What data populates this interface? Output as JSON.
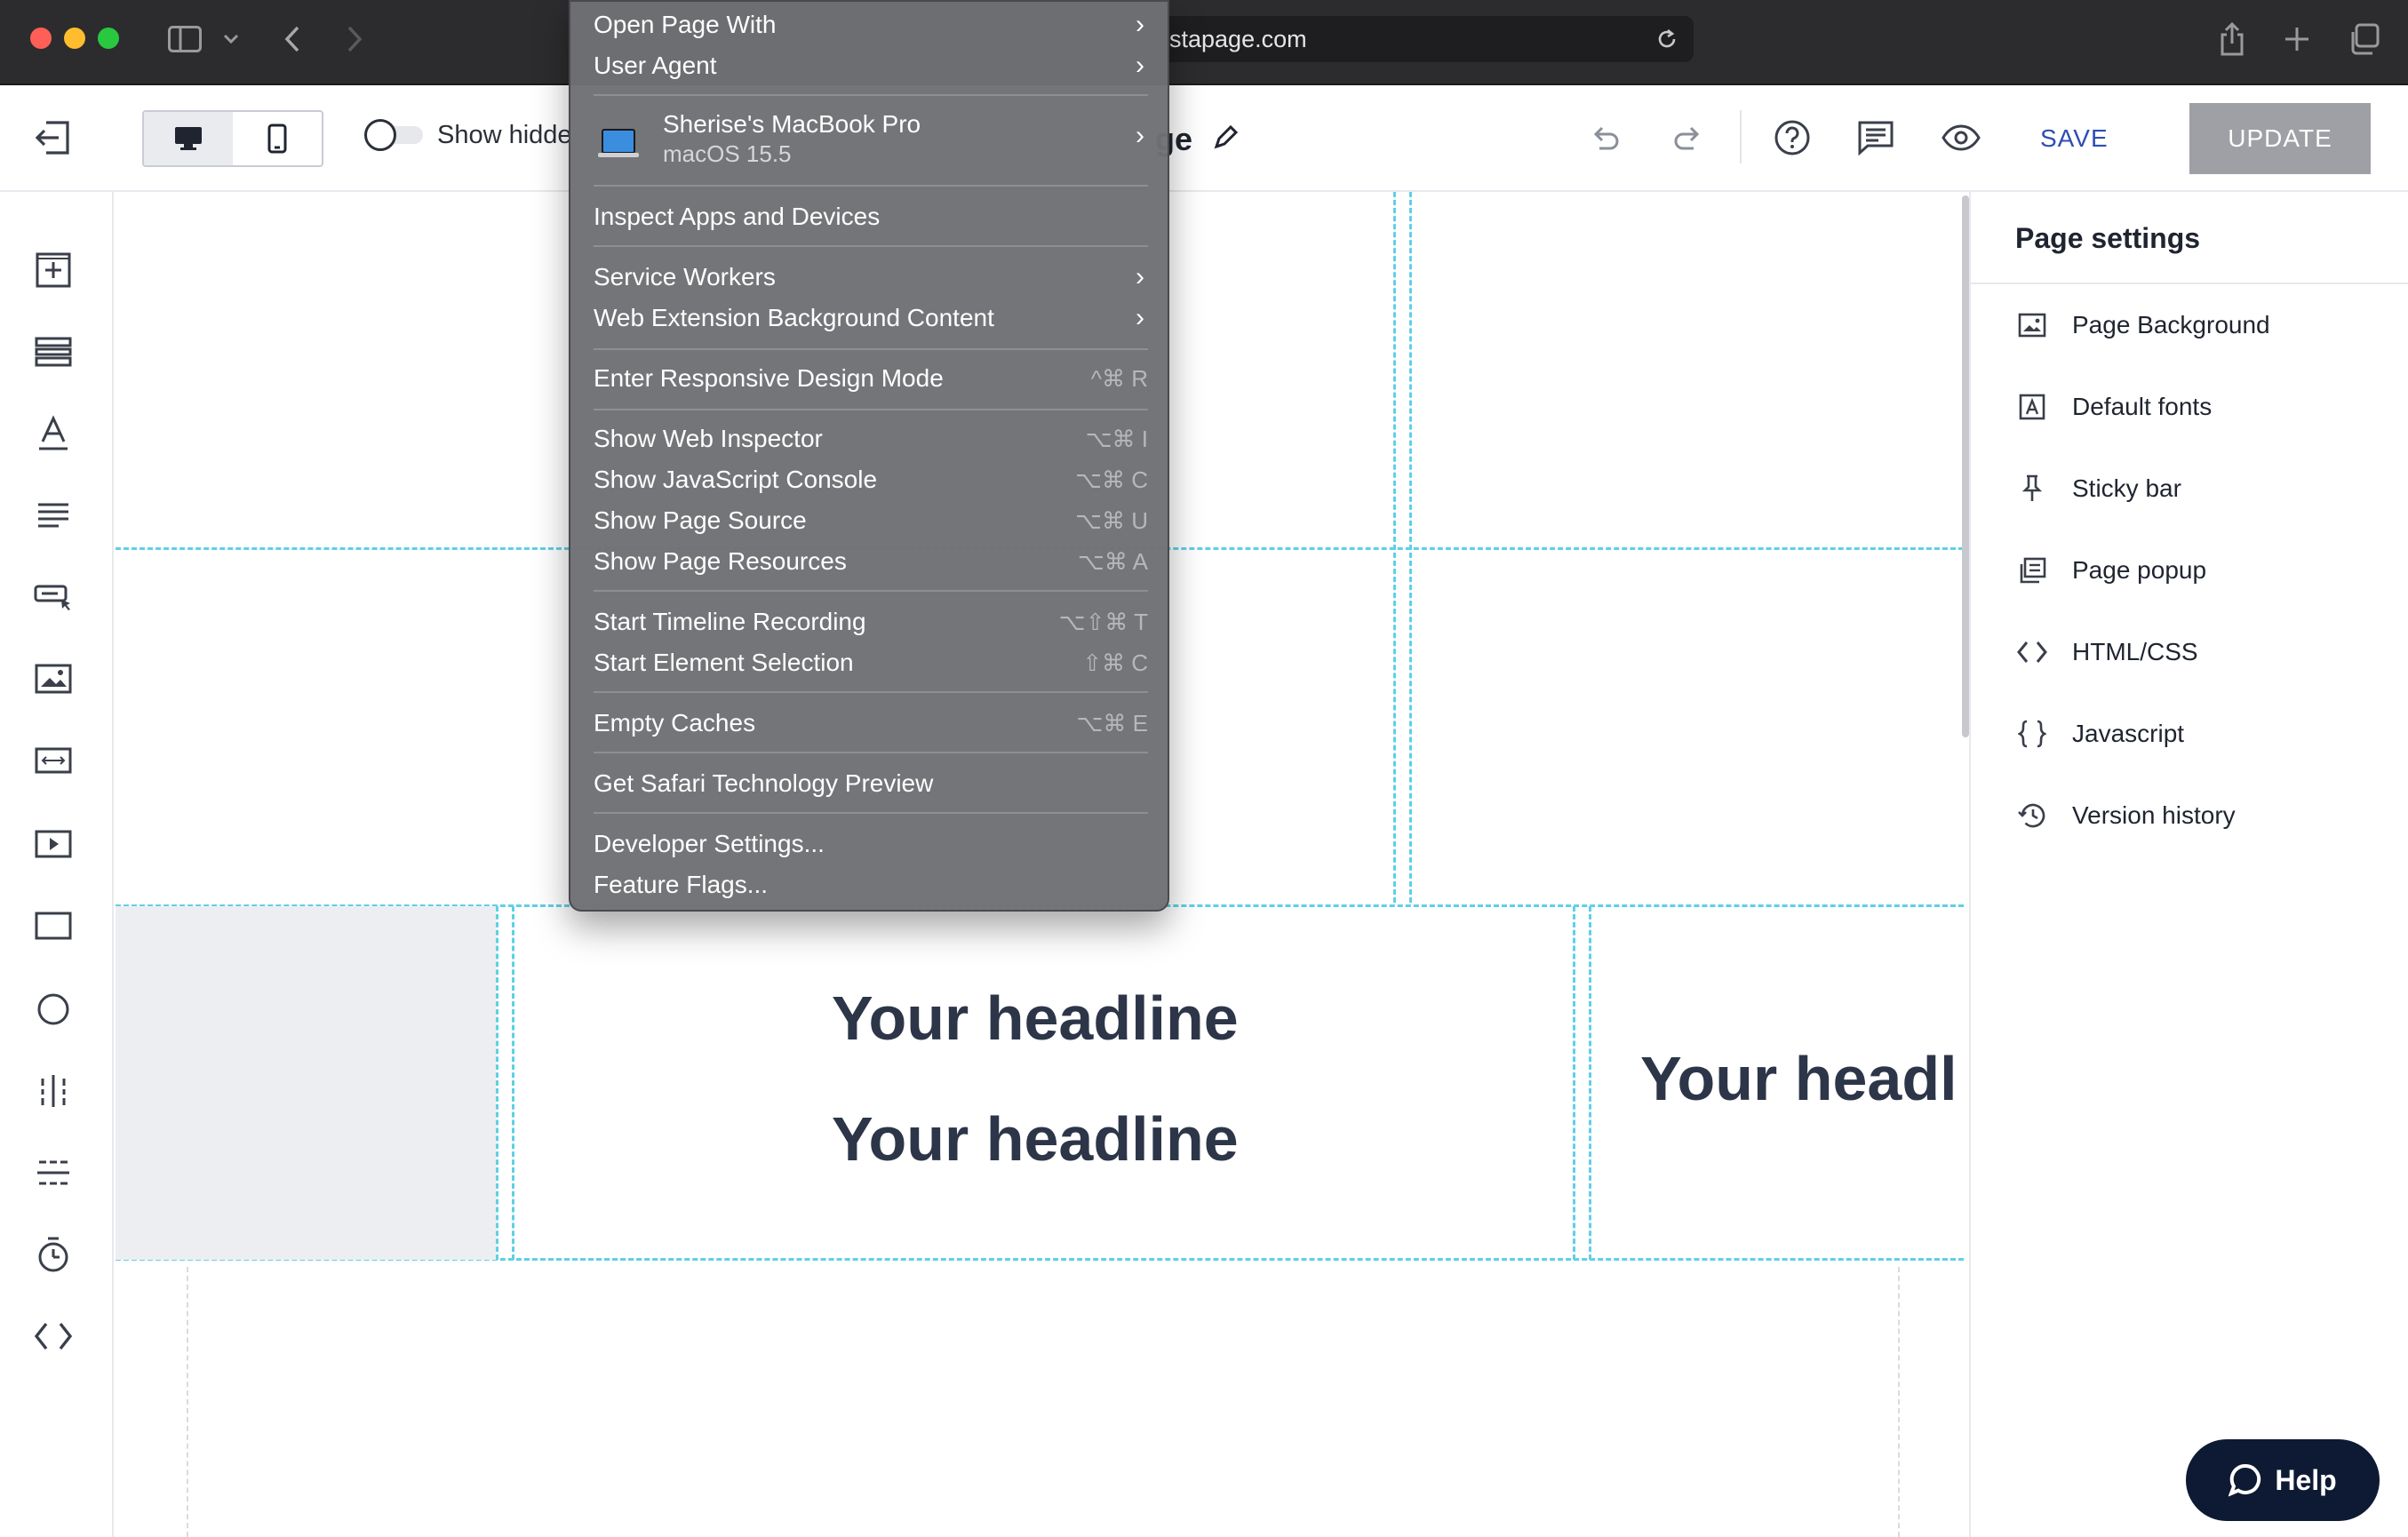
{
  "browser": {
    "url": "stapage.com"
  },
  "toolbar": {
    "show_hidden_label": "Show hidde",
    "page_name_fragment": "ge",
    "save_label": "SAVE",
    "update_label": "UPDATE"
  },
  "canvas": {
    "headline_1": "Your headline",
    "headline_2": "Your headline",
    "headline_3": "Your headl"
  },
  "right_panel": {
    "title": "Page settings",
    "items": [
      {
        "label": "Page Background",
        "icon": "image-icon"
      },
      {
        "label": "Default fonts",
        "icon": "font-icon"
      },
      {
        "label": "Sticky bar",
        "icon": "pin-icon"
      },
      {
        "label": "Page popup",
        "icon": "popup-icon"
      },
      {
        "label": "HTML/CSS",
        "icon": "code-icon"
      },
      {
        "label": "Javascript",
        "icon": "braces-icon"
      },
      {
        "label": "Version history",
        "icon": "history-icon"
      }
    ]
  },
  "help": {
    "label": "Help"
  },
  "develop_menu": {
    "open_page_with": "Open Page With",
    "user_agent": "User Agent",
    "device_name": "Sherise's MacBook Pro",
    "device_os": "macOS 15.5",
    "inspect_apps": "Inspect Apps and Devices",
    "service_workers": "Service Workers",
    "web_extension_bg": "Web Extension Background Content",
    "responsive_mode": "Enter Responsive Design Mode",
    "responsive_mode_sc": "^⌘ R",
    "show_web_inspector": "Show Web Inspector",
    "show_web_inspector_sc": "⌥⌘ I",
    "show_js_console": "Show JavaScript Console",
    "show_js_console_sc": "⌥⌘ C",
    "show_page_source": "Show Page Source",
    "show_page_source_sc": "⌥⌘ U",
    "show_page_resources": "Show Page Resources",
    "show_page_resources_sc": "⌥⌘ A",
    "start_timeline": "Start Timeline Recording",
    "start_timeline_sc": "⌥⇧⌘ T",
    "start_element_sel": "Start Element Selection",
    "start_element_sel_sc": "⇧⌘ C",
    "empty_caches": "Empty Caches",
    "empty_caches_sc": "⌥⌘ E",
    "get_stp": "Get Safari Technology Preview",
    "developer_settings": "Developer Settings...",
    "feature_flags": "Feature Flags..."
  }
}
